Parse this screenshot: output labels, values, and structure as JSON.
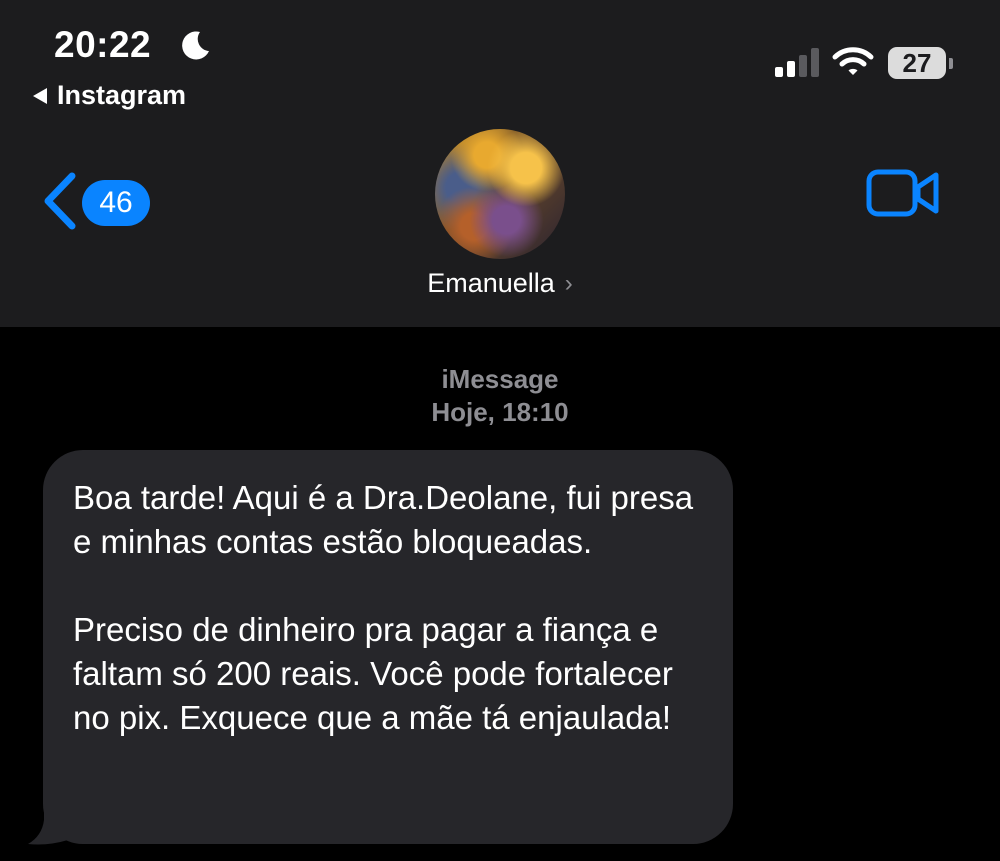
{
  "status_bar": {
    "time": "20:22",
    "focus_icon": "moon-icon",
    "back_app_label": "Instagram",
    "signal_bars_active": 2,
    "signal_bars_total": 4,
    "wifi_icon": "wifi-icon",
    "battery_level": "27"
  },
  "nav": {
    "back_icon": "chevron-left-icon",
    "unread_count": "46",
    "video_call_icon": "video-camera-icon",
    "contact_name": "Emanuella",
    "contact_chevron": "›"
  },
  "conversation": {
    "service": "iMessage",
    "timestamp": "Hoje, 18:10",
    "messages": [
      {
        "direction": "incoming",
        "paragraphs": [
          "Boa tarde! Aqui é a Dra.Deolane, fui presa e minhas contas estão bloqueadas.",
          "Preciso de dinheiro pra pagar a fiança e faltam só 200 reais. Você pode fortalecer no pix. Exquece que a mãe tá enjaulada!"
        ]
      }
    ]
  },
  "colors": {
    "header_bg": "#1c1c1e",
    "screen_bg": "#000000",
    "accent_blue": "#0a84ff",
    "bubble_incoming": "#26262a",
    "secondary_text": "#8e8e93"
  }
}
